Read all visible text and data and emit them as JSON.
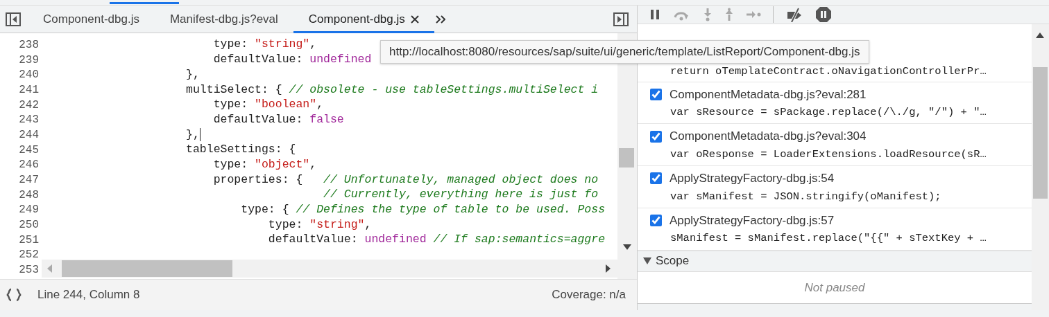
{
  "editor_tabs": [
    {
      "label": "Component-dbg.js",
      "selected": false,
      "closable": false
    },
    {
      "label": "Manifest-dbg.js?eval",
      "selected": false,
      "closable": false
    },
    {
      "label": "Component-dbg.js",
      "selected": true,
      "closable": true
    }
  ],
  "code_lines": [
    {
      "number": "238",
      "caret": false,
      "segments": [
        {
          "kind": "plain",
          "text": "                        type: "
        },
        {
          "kind": "string",
          "text": "\"string\""
        },
        {
          "kind": "plain",
          "text": ","
        }
      ]
    },
    {
      "number": "239",
      "caret": false,
      "segments": [
        {
          "kind": "plain",
          "text": "                        defaultValue: "
        },
        {
          "kind": "keyword",
          "text": "undefined"
        }
      ]
    },
    {
      "number": "240",
      "caret": false,
      "segments": [
        {
          "kind": "plain",
          "text": "                    },"
        }
      ]
    },
    {
      "number": "241",
      "caret": false,
      "segments": [
        {
          "kind": "plain",
          "text": "                    multiSelect: { "
        },
        {
          "kind": "comment",
          "text": "// obsolete - use tableSettings.multiSelect i"
        }
      ]
    },
    {
      "number": "242",
      "caret": false,
      "segments": [
        {
          "kind": "plain",
          "text": "                        type: "
        },
        {
          "kind": "string",
          "text": "\"boolean\""
        },
        {
          "kind": "plain",
          "text": ","
        }
      ]
    },
    {
      "number": "243",
      "caret": false,
      "segments": [
        {
          "kind": "plain",
          "text": "                        defaultValue: "
        },
        {
          "kind": "keyword",
          "text": "false"
        }
      ]
    },
    {
      "number": "244",
      "caret": true,
      "segments": [
        {
          "kind": "plain",
          "text": "                    },"
        }
      ]
    },
    {
      "number": "245",
      "caret": false,
      "segments": [
        {
          "kind": "plain",
          "text": "                    tableSettings: {"
        }
      ]
    },
    {
      "number": "246",
      "caret": false,
      "segments": [
        {
          "kind": "plain",
          "text": "                        type: "
        },
        {
          "kind": "string",
          "text": "\"object\""
        },
        {
          "kind": "plain",
          "text": ","
        }
      ]
    },
    {
      "number": "247",
      "caret": false,
      "segments": [
        {
          "kind": "plain",
          "text": "                        properties: {   "
        },
        {
          "kind": "comment",
          "text": "// Unfortunately, managed object does no"
        }
      ]
    },
    {
      "number": "248",
      "caret": false,
      "segments": [
        {
          "kind": "comment",
          "text": "                                        // Currently, everything here is just fo"
        }
      ]
    },
    {
      "number": "249",
      "caret": false,
      "segments": [
        {
          "kind": "plain",
          "text": "                            type: { "
        },
        {
          "kind": "comment",
          "text": "// Defines the type of table to be used. Poss"
        }
      ]
    },
    {
      "number": "250",
      "caret": false,
      "segments": [
        {
          "kind": "plain",
          "text": "                                type: "
        },
        {
          "kind": "string",
          "text": "\"string\""
        },
        {
          "kind": "plain",
          "text": ","
        }
      ]
    },
    {
      "number": "251",
      "caret": false,
      "segments": [
        {
          "kind": "plain",
          "text": "                                defaultValue: "
        },
        {
          "kind": "keyword",
          "text": "undefined"
        },
        {
          "kind": "comment",
          "text": " // If sap:semantics=aggre"
        }
      ]
    },
    {
      "number": "252"
    },
    {
      "number": "253"
    }
  ],
  "tooltip": "http://localhost:8080/resources/sap/suite/ui/generic/template/ListReport/Component-dbg.js",
  "status_bar": {
    "position": "Line 244, Column 8",
    "coverage": "Coverage: n/a"
  },
  "debugger_toolbar": [
    {
      "kind": "pause",
      "disabled": false
    },
    {
      "kind": "step-over",
      "disabled": true
    },
    {
      "kind": "step-into",
      "disabled": true
    },
    {
      "kind": "step-out",
      "disabled": true
    },
    {
      "kind": "step",
      "disabled": true
    },
    {
      "kind": "separator"
    },
    {
      "kind": "deactivate-breakpoints",
      "disabled": false
    },
    {
      "kind": "pause-on-exceptions",
      "disabled": false
    }
  ],
  "breakpoints": [
    {
      "code": "return oTemplateContract.oNavigationControllerPr…"
    },
    {
      "location": "ComponentMetadata-dbg.js?eval:281",
      "checked": true,
      "code": "var sResource = sPackage.replace(/\\./g, \"/\") + \"…"
    },
    {
      "location": "ComponentMetadata-dbg.js?eval:304",
      "checked": true,
      "code": "var oResponse = LoaderExtensions.loadResource(sR…"
    },
    {
      "location": "ApplyStrategyFactory-dbg.js:54",
      "checked": true,
      "code": "var sManifest = JSON.stringify(oManifest);"
    },
    {
      "location": "ApplyStrategyFactory-dbg.js:57",
      "checked": true,
      "code": "sManifest = sManifest.replace(\"{{\" + sTextKey + …"
    }
  ],
  "scope": {
    "title": "Scope",
    "expanded": true,
    "message": "Not paused"
  }
}
